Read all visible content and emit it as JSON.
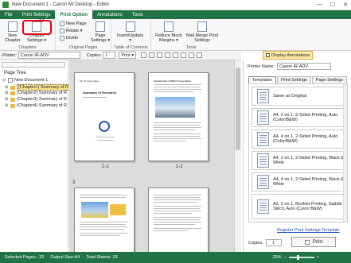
{
  "window": {
    "title": "New Document 1 - Canon iW Desktop - Editor",
    "minimize": "—",
    "maximize": "☐",
    "close": "✕"
  },
  "tabs": [
    "File",
    "Print Settings",
    "Print Option",
    "Annotations",
    "Tools"
  ],
  "active_tab": "Print Option",
  "ribbon": {
    "chapters": {
      "group_label": "Chapters",
      "new_chapter": "New\nChapter",
      "chapter_settings": "Chapter\nSettings ▾"
    },
    "original_pages": {
      "group_label": "Original Pages",
      "new_page": "New Page",
      "rotate": "Rotate ▾",
      "divide": "Divide",
      "page_settings": "Page\nSettings ▾"
    },
    "toc": {
      "group_label": "Table of Contents",
      "insert_update": "Insert/Update\n▾"
    },
    "tools": {
      "group_label": "Tools",
      "reduce_block": "Reduce Block\nMargins ▾",
      "mail_merge": "Mail Merge Print\nSettings"
    }
  },
  "toolbar": {
    "printer_label": "Printer:",
    "printer_value": "Canon iR-ADV",
    "copies_label": "Copies:",
    "copies_value": "1",
    "print_label": "Print ▾",
    "display_annotations": "Display Annotations"
  },
  "page_tree": {
    "label": "Page Tree",
    "items": [
      {
        "label": "New Document 1",
        "level": 0,
        "expander": "⊟"
      },
      {
        "label": "(Chapter1) Summary of R",
        "level": 1,
        "expander": "⊞",
        "selected": true
      },
      {
        "label": "(Chapter2) Summary of R",
        "level": 1,
        "expander": "⊞"
      },
      {
        "label": "(Chapter3) Summary of R",
        "level": 1,
        "expander": "⊞"
      },
      {
        "label": "(Chapter4) Summary of R",
        "level": 1,
        "expander": "⊞"
      }
    ]
  },
  "pages": [
    {
      "label": "1-1",
      "heading": "Summary of Research"
    },
    {
      "label": "1-2",
      "heading": "Introduction of Mt.IX Corporation"
    },
    {
      "label": "3",
      "heading": ""
    },
    {
      "label": "",
      "heading": ""
    }
  ],
  "right_panel": {
    "printer_label": "Printer Name:",
    "printer_value": "Canon iR-ADV",
    "tabs": [
      "Templates",
      "Print Settings",
      "Page Settings"
    ],
    "templates": [
      "Same as Original",
      "A4, 2 on 1, 2-Sided Printing, Auto (Color/B&W)",
      "A4, 4 on 1, 2-Sided Printing, Auto (Color/B&W)",
      "A4, 2 on 1, 2-Sided Printing, Black & White",
      "A4, 4 on 1, 2-Sided Printing, Black & White",
      "A3, 2 on 1, Booklet Printing, Saddle Stitch, Auto (Color/ B&W)"
    ],
    "register_link": "Register Print Settings Template",
    "copies_label": "Copies:",
    "copies_value": "1",
    "print_button": "Print"
  },
  "status": {
    "selected_pages": "Selected Pages : 33",
    "output_size": "Output Size:A4",
    "total_sheets": "Total Sheets: 33",
    "zoom": "25%"
  },
  "colors": {
    "accent": "#217346",
    "highlight": "#e60012"
  }
}
